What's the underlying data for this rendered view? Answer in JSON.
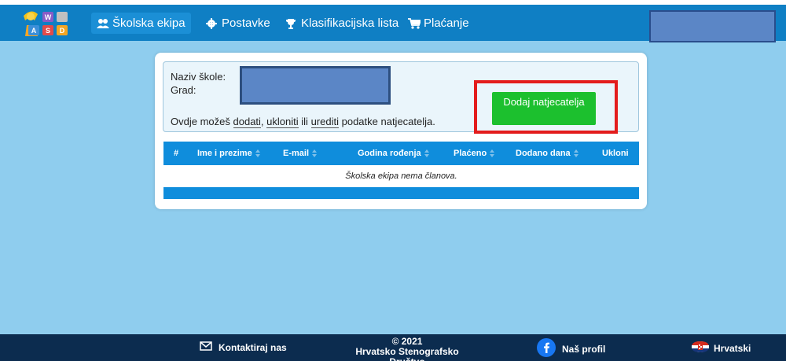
{
  "nav": {
    "items": [
      {
        "label": "Školska ekipa",
        "icon": "users-icon"
      },
      {
        "label": "Postavke",
        "icon": "gear-icon"
      },
      {
        "label": "Klasifikacijska lista",
        "icon": "trophy-icon"
      },
      {
        "label": "Plaćanje",
        "icon": "cart-icon"
      }
    ],
    "logo_letters": [
      "W",
      "A",
      "S",
      "D"
    ]
  },
  "school": {
    "name_label": "Naziv škole:",
    "city_label": "Grad:",
    "help_prefix": "Ovdje možeš",
    "help_add": "dodati",
    "help_comma": ",",
    "help_remove": "ukloniti",
    "help_or": "ili",
    "help_edit": "urediti",
    "help_suffix": "podatke natjecatelja.",
    "add_button": "Dodaj natjecatelja"
  },
  "table": {
    "columns": [
      "#",
      "Ime i prezime",
      "E-mail",
      "Godina rođenja",
      "Plaćeno",
      "Dodano dana",
      "Ukloni"
    ],
    "empty_message": "Školska ekipa nema članova."
  },
  "footer": {
    "contact": "Kontaktiraj nas",
    "copyright_year": "© 2021",
    "organization": "Hrvatsko Stenografsko Društvo",
    "profile": "Naš profil",
    "language": "Hrvatski"
  },
  "colors": {
    "navbar": "#0f7fc4",
    "page_bg": "#8fcdee",
    "table_header": "#0f8ddc",
    "add_button": "#1cc02e",
    "highlight": "#e31c1c",
    "footer": "#0c2c4f"
  }
}
